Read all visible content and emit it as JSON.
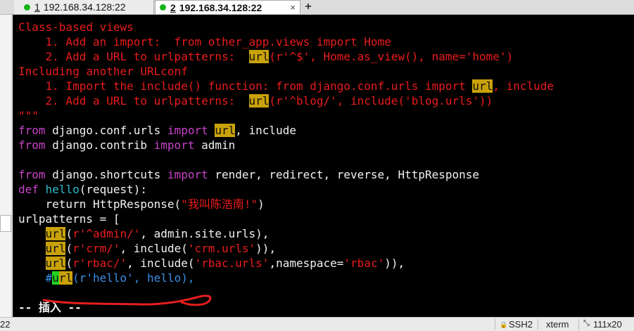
{
  "tabs": [
    {
      "number": "1",
      "title": "192.168.34.128:22",
      "active": false
    },
    {
      "number": "2",
      "title": "192.168.34.128:22",
      "active": true,
      "close": "×"
    }
  ],
  "new_tab_label": "+",
  "terminal": {
    "lines": [
      {
        "segments": [
          {
            "text": "Class-based views",
            "color": "red"
          }
        ]
      },
      {
        "segments": [
          {
            "text": "    1. Add an import:  from other_app.views import Home",
            "color": "red"
          }
        ]
      },
      {
        "segments": [
          {
            "text": "    2. Add a URL to urlpatterns:  ",
            "color": "red"
          },
          {
            "text": "url",
            "color": "red",
            "highlight": true
          },
          {
            "text": "(r'^$', Home.as_view(), name='home')",
            "color": "red"
          }
        ]
      },
      {
        "segments": [
          {
            "text": "Including another URLconf",
            "color": "red"
          }
        ]
      },
      {
        "segments": [
          {
            "text": "    1. Import the include() function: from django.conf.urls import ",
            "color": "red"
          },
          {
            "text": "url",
            "color": "red",
            "highlight": true
          },
          {
            "text": ", include",
            "color": "red"
          }
        ]
      },
      {
        "segments": [
          {
            "text": "    2. Add a URL to urlpatterns:  ",
            "color": "red"
          },
          {
            "text": "url",
            "color": "red",
            "highlight": true
          },
          {
            "text": "(r'^blog/', include('blog.urls'))",
            "color": "red"
          }
        ]
      },
      {
        "segments": [
          {
            "text": "\"\"\"",
            "color": "red"
          }
        ]
      },
      {
        "segments": [
          {
            "text": "from",
            "color": "magenta"
          },
          {
            "text": " django.conf.urls ",
            "color": "white"
          },
          {
            "text": "import",
            "color": "magenta"
          },
          {
            "text": " ",
            "color": "white"
          },
          {
            "text": "url",
            "color": "white",
            "highlight": true
          },
          {
            "text": ", include",
            "color": "white"
          }
        ]
      },
      {
        "segments": [
          {
            "text": "from",
            "color": "magenta"
          },
          {
            "text": " django.contrib ",
            "color": "white"
          },
          {
            "text": "import",
            "color": "magenta"
          },
          {
            "text": " admin",
            "color": "white"
          }
        ]
      },
      {
        "segments": [
          {
            "text": "",
            "color": "white"
          }
        ]
      },
      {
        "segments": [
          {
            "text": "from",
            "color": "magenta"
          },
          {
            "text": " django.shortcuts ",
            "color": "white"
          },
          {
            "text": "import",
            "color": "magenta"
          },
          {
            "text": " render, redirect, reverse, HttpResponse",
            "color": "white"
          }
        ]
      },
      {
        "segments": [
          {
            "text": "def",
            "color": "magenta"
          },
          {
            "text": " ",
            "color": "white"
          },
          {
            "text": "hello",
            "color": "cyan"
          },
          {
            "text": "(request):",
            "color": "white"
          }
        ]
      },
      {
        "segments": [
          {
            "text": "    return HttpResponse(",
            "color": "white"
          },
          {
            "text": "\"我叫陈浩南!\"",
            "color": "red"
          },
          {
            "text": ")",
            "color": "white"
          }
        ]
      },
      {
        "segments": [
          {
            "text": "urlpatterns = [",
            "color": "white"
          }
        ]
      },
      {
        "segments": [
          {
            "text": "    ",
            "color": "white"
          },
          {
            "text": "url",
            "color": "white",
            "highlight": true
          },
          {
            "text": "(",
            "color": "white"
          },
          {
            "text": "r'^admin/'",
            "color": "red"
          },
          {
            "text": ", admin.site.urls),",
            "color": "white"
          }
        ]
      },
      {
        "segments": [
          {
            "text": "    ",
            "color": "white"
          },
          {
            "text": "url",
            "color": "white",
            "highlight": true
          },
          {
            "text": "(",
            "color": "white"
          },
          {
            "text": "r'crm/'",
            "color": "red"
          },
          {
            "text": ", include(",
            "color": "white"
          },
          {
            "text": "'crm.urls'",
            "color": "red"
          },
          {
            "text": ")),",
            "color": "white"
          }
        ]
      },
      {
        "segments": [
          {
            "text": "    ",
            "color": "white"
          },
          {
            "text": "url",
            "color": "white",
            "highlight": true
          },
          {
            "text": "(",
            "color": "white"
          },
          {
            "text": "r'rbac/'",
            "color": "red"
          },
          {
            "text": ", include(",
            "color": "white"
          },
          {
            "text": "'rbac.urls'",
            "color": "red"
          },
          {
            "text": ",namespace=",
            "color": "white"
          },
          {
            "text": "'rbac'",
            "color": "red"
          },
          {
            "text": ")),",
            "color": "white"
          }
        ]
      },
      {
        "segments": [
          {
            "text": "    #",
            "color": "blue"
          },
          {
            "text": "u",
            "color": "blue",
            "cursor": true
          },
          {
            "text": "rl",
            "color": "blue",
            "highlight": true
          },
          {
            "text": "(r'hello', hello),",
            "color": "blue"
          }
        ]
      },
      {
        "segments": [
          {
            "text": "",
            "color": "white"
          }
        ]
      },
      {
        "segments": [
          {
            "text": "-- 插入 --",
            "color": "white",
            "bold": true
          }
        ]
      }
    ]
  },
  "statusbar": {
    "left": "22",
    "protocol": "SSH2",
    "terminal_type": "xterm",
    "size": "111x20"
  },
  "colors": {
    "red": "#ea1c1c",
    "magenta": "#c744c7",
    "cyan": "#34b9cf",
    "white": "#f2f2f2",
    "blue": "#3b8ee6",
    "highlight": "#c9a209",
    "cursor": "#22d422",
    "annotation": "#e61e1e"
  }
}
